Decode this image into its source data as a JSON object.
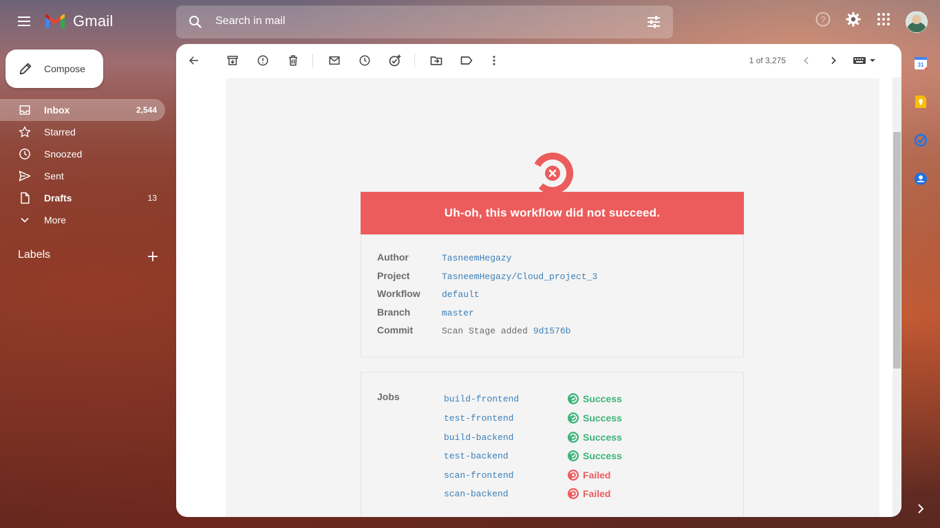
{
  "app": {
    "name": "Gmail"
  },
  "search": {
    "placeholder": "Search in mail"
  },
  "compose": {
    "label": "Compose"
  },
  "nav": [
    {
      "label": "Inbox",
      "count": "2,544",
      "icon": "inbox-icon",
      "active": true
    },
    {
      "label": "Starred",
      "count": "",
      "icon": "star-icon"
    },
    {
      "label": "Snoozed",
      "count": "",
      "icon": "clock-icon"
    },
    {
      "label": "Sent",
      "count": "",
      "icon": "send-icon"
    },
    {
      "label": "Drafts",
      "count": "13",
      "icon": "draft-icon"
    },
    {
      "label": "More",
      "count": "",
      "icon": "chevron-down-icon"
    }
  ],
  "labels": {
    "heading": "Labels"
  },
  "toolbar": {
    "pager": "1 of 3,275"
  },
  "email": {
    "banner": "Uh-oh, this workflow did not succeed.",
    "meta": [
      {
        "key": "Author",
        "value": "TasneemHegazy"
      },
      {
        "key": "Project",
        "value": "TasneemHegazy/Cloud_project_3"
      },
      {
        "key": "Workflow",
        "value": "default"
      },
      {
        "key": "Branch",
        "value": "master"
      }
    ],
    "commit": {
      "key": "Commit",
      "message": "Scan Stage added",
      "hash": "9d1576b"
    },
    "jobs_label": "Jobs",
    "jobs": [
      {
        "name": "build-frontend",
        "status": "Success"
      },
      {
        "name": "test-frontend",
        "status": "Success"
      },
      {
        "name": "build-backend",
        "status": "Success"
      },
      {
        "name": "test-backend",
        "status": "Success"
      },
      {
        "name": "scan-frontend",
        "status": "Failed"
      },
      {
        "name": "scan-backend",
        "status": "Failed"
      }
    ]
  },
  "colors": {
    "fail": "#ed5c5c",
    "success": "#3db37a",
    "link": "#3c7fb8"
  }
}
